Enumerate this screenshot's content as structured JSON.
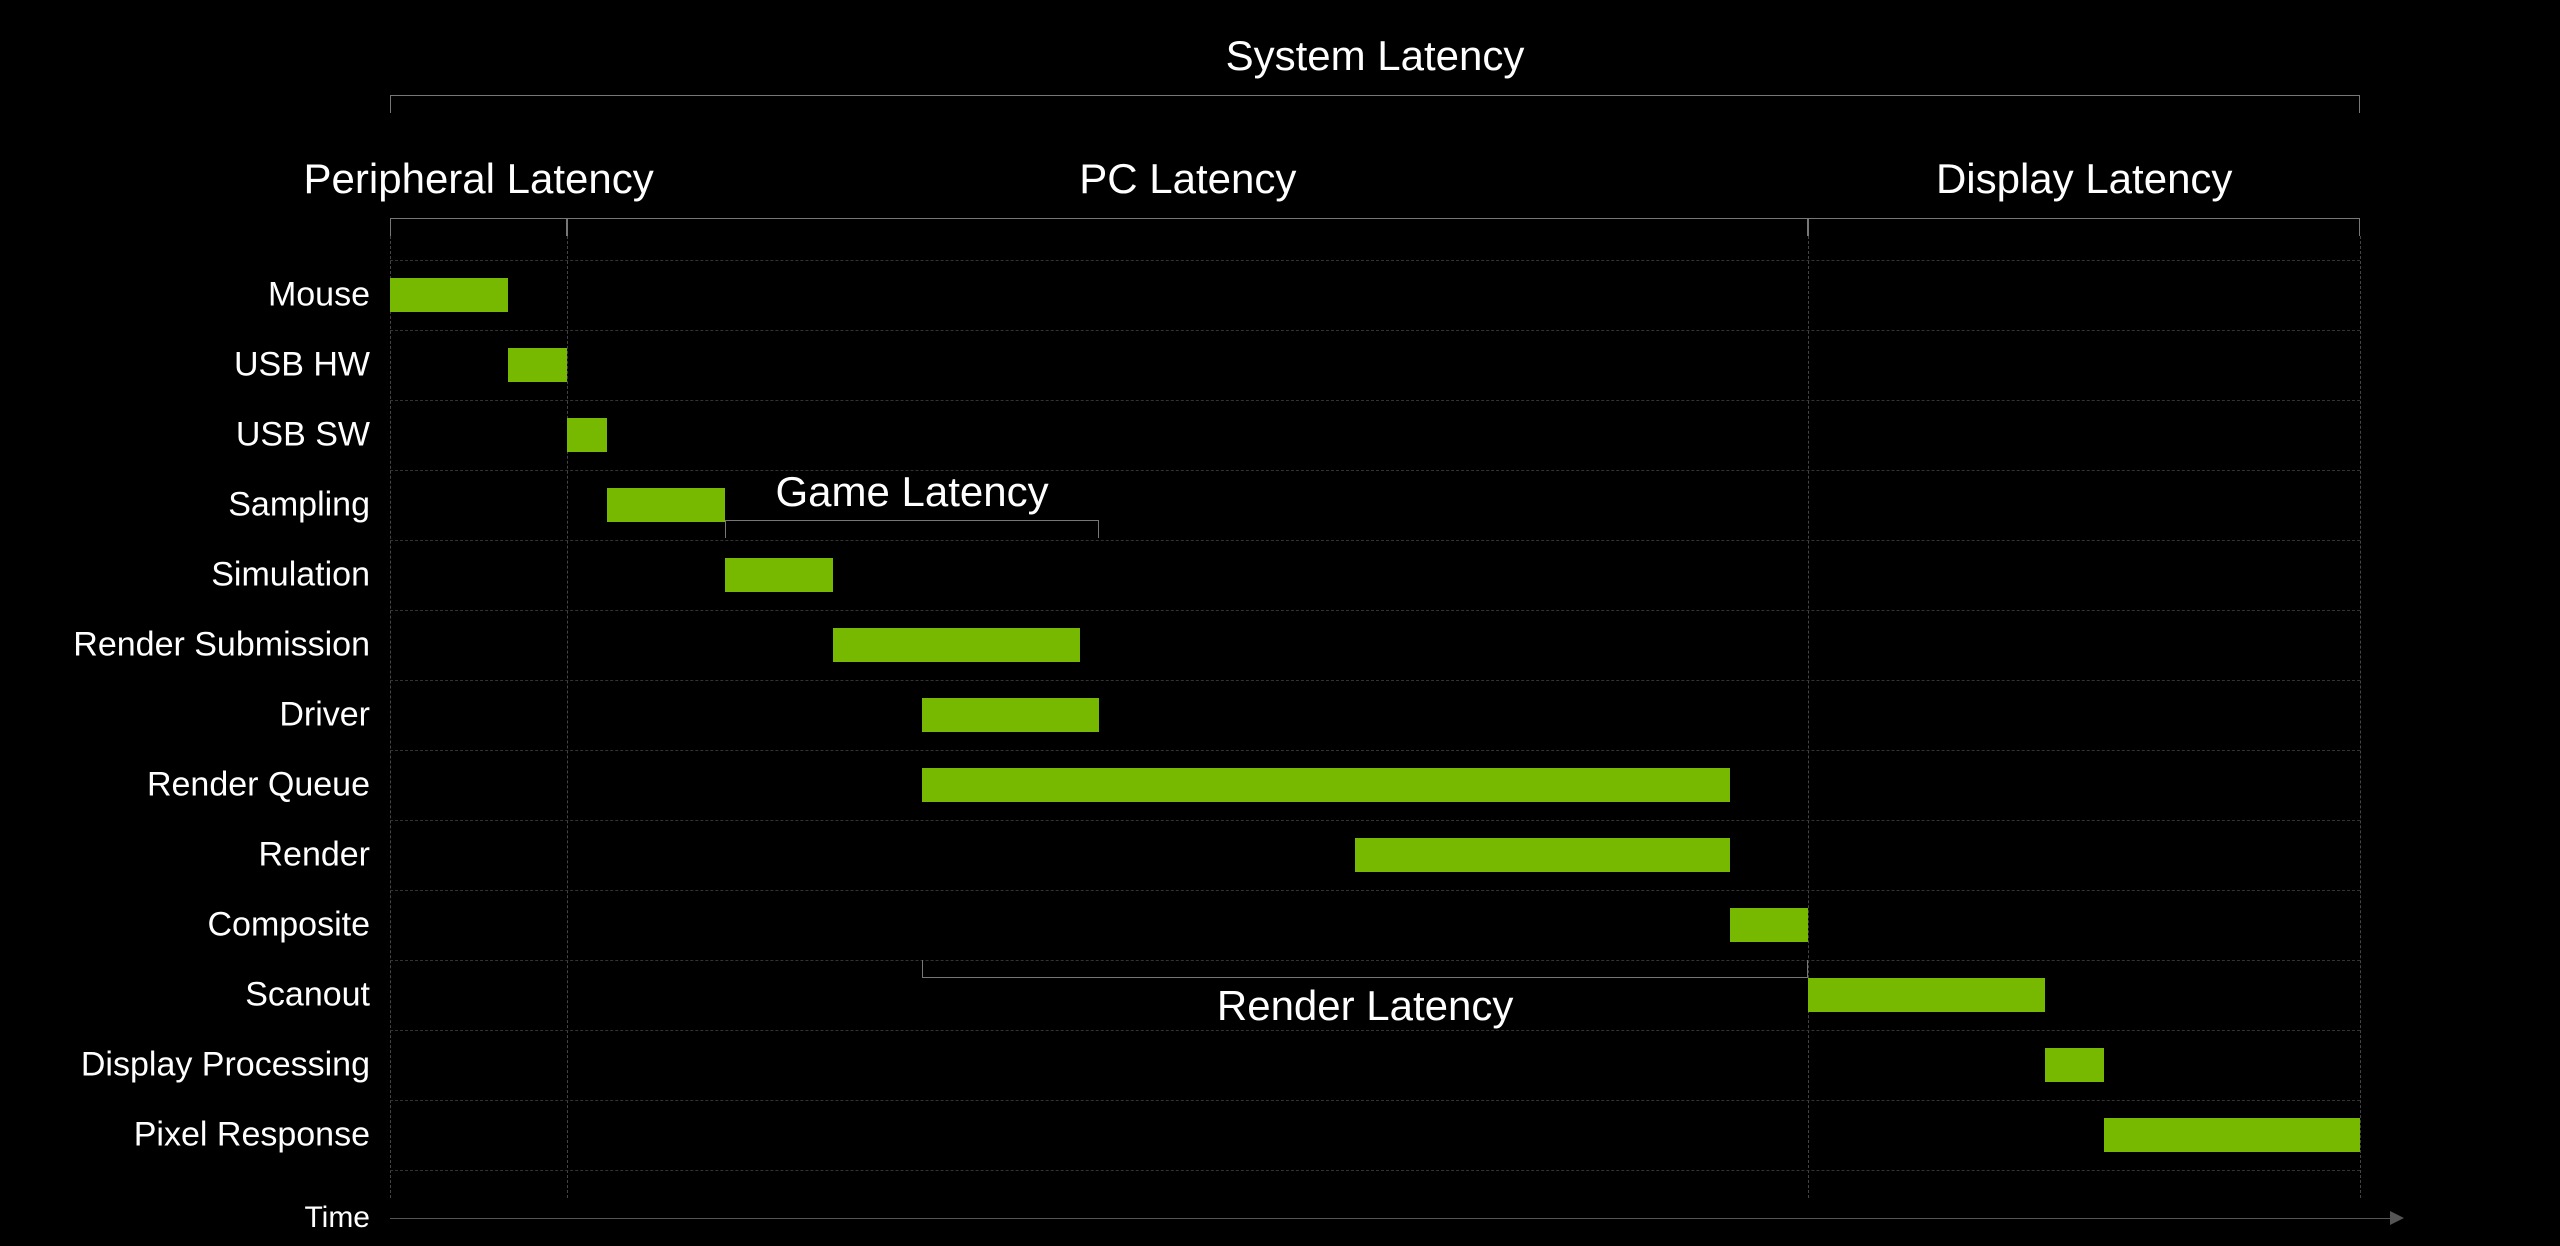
{
  "chart_data": {
    "type": "gantt",
    "title": "System Latency",
    "groups": [
      {
        "name": "Peripheral Latency",
        "start": 0,
        "end": 90
      },
      {
        "name": "PC Latency",
        "start": 90,
        "end": 720
      },
      {
        "name": "Display Latency",
        "start": 720,
        "end": 1000
      }
    ],
    "sub_groups": [
      {
        "name": "Game Latency",
        "start": 170,
        "end": 360
      },
      {
        "name": "Render Latency",
        "start": 270,
        "end": 720
      }
    ],
    "rows": [
      {
        "label": "Mouse",
        "start": 0,
        "end": 60
      },
      {
        "label": "USB HW",
        "start": 60,
        "end": 90
      },
      {
        "label": "USB SW",
        "start": 90,
        "end": 110
      },
      {
        "label": "Sampling",
        "start": 110,
        "end": 170
      },
      {
        "label": "Simulation",
        "start": 170,
        "end": 225
      },
      {
        "label": "Render Submission",
        "start": 225,
        "end": 350
      },
      {
        "label": "Driver",
        "start": 270,
        "end": 360
      },
      {
        "label": "Render Queue",
        "start": 270,
        "end": 680
      },
      {
        "label": "Render",
        "start": 490,
        "end": 680
      },
      {
        "label": "Composite",
        "start": 680,
        "end": 720
      },
      {
        "label": "Scanout",
        "start": 720,
        "end": 840
      },
      {
        "label": "Display Processing",
        "start": 840,
        "end": 870
      },
      {
        "label": "Pixel Response",
        "start": 870,
        "end": 1000
      }
    ],
    "x_axis_label": "Time",
    "x_range": [
      0,
      1000
    ]
  },
  "layout": {
    "labelRight": 370,
    "chartLeft": 390,
    "chartRight": 2360,
    "rowTop": 295,
    "rowStep": 70,
    "titleY": 32,
    "bracket1Y": 95,
    "groupTitleY": 155,
    "bracket2Y": 218,
    "axisY": 1218
  }
}
